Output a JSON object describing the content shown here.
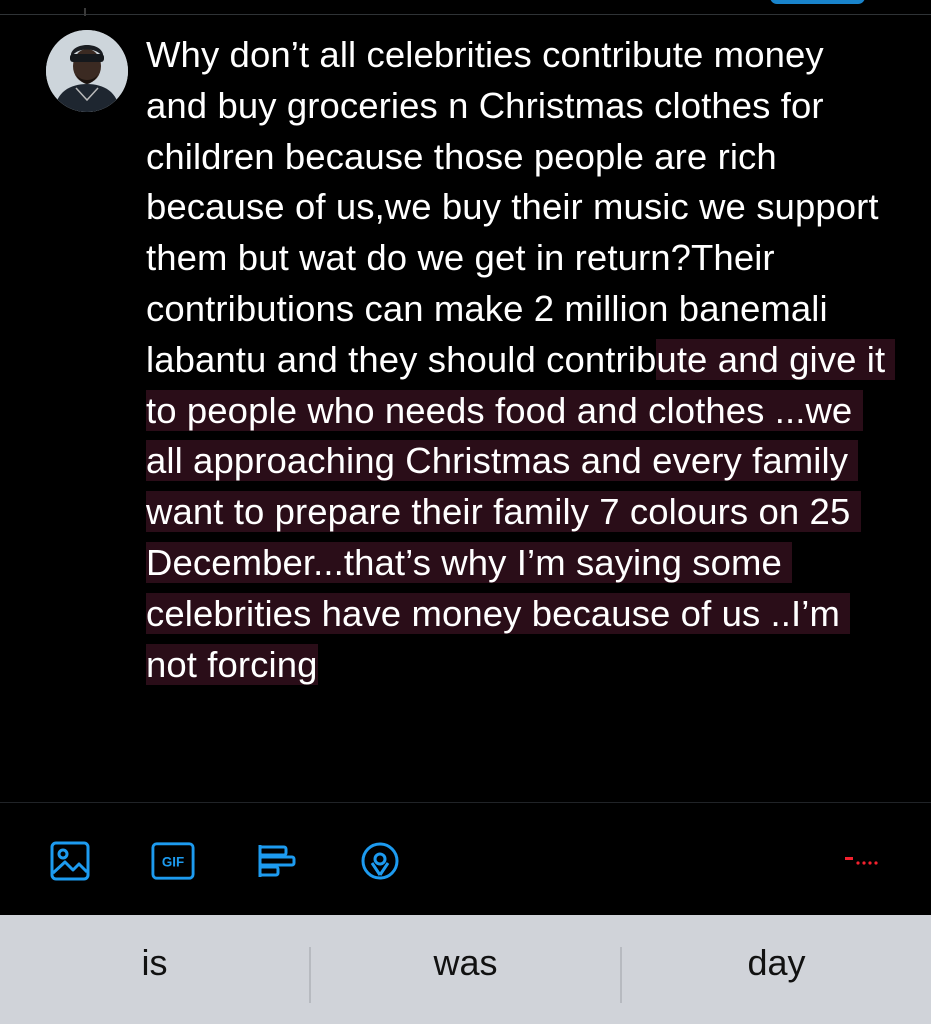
{
  "theme": {
    "background": "#000000",
    "accent": "#1d9bf0",
    "overflow_highlight": "#2a0d18",
    "overflow_indicator": "#f4212e",
    "suggestion_bar": "#d0d3d9"
  },
  "compose": {
    "avatar_alt": "avatar",
    "text_within_limit": "Why don’t all celebrities contribute money and buy groceries n Christmas clothes for children because those people are rich because of us,we buy their music we support them but wat do we get in return?Their contributions can make 2 million banemali labantu and they should contrib",
    "text_over_limit": "ute and give it to people who needs food and clothes ...we all approaching Christmas and every family want to prepare their family 7 colours on 25 December...that’s why I’m saying some celebrities have money because of us ..I’m not forcing"
  },
  "toolbar": {
    "icons": [
      "image-icon",
      "gif-icon",
      "poll-icon",
      "location-icon"
    ],
    "gif_label": "GIF",
    "counter_icon": "character-counter-icon"
  },
  "keyboard": {
    "suggestions": [
      "is",
      "was",
      "day"
    ]
  }
}
